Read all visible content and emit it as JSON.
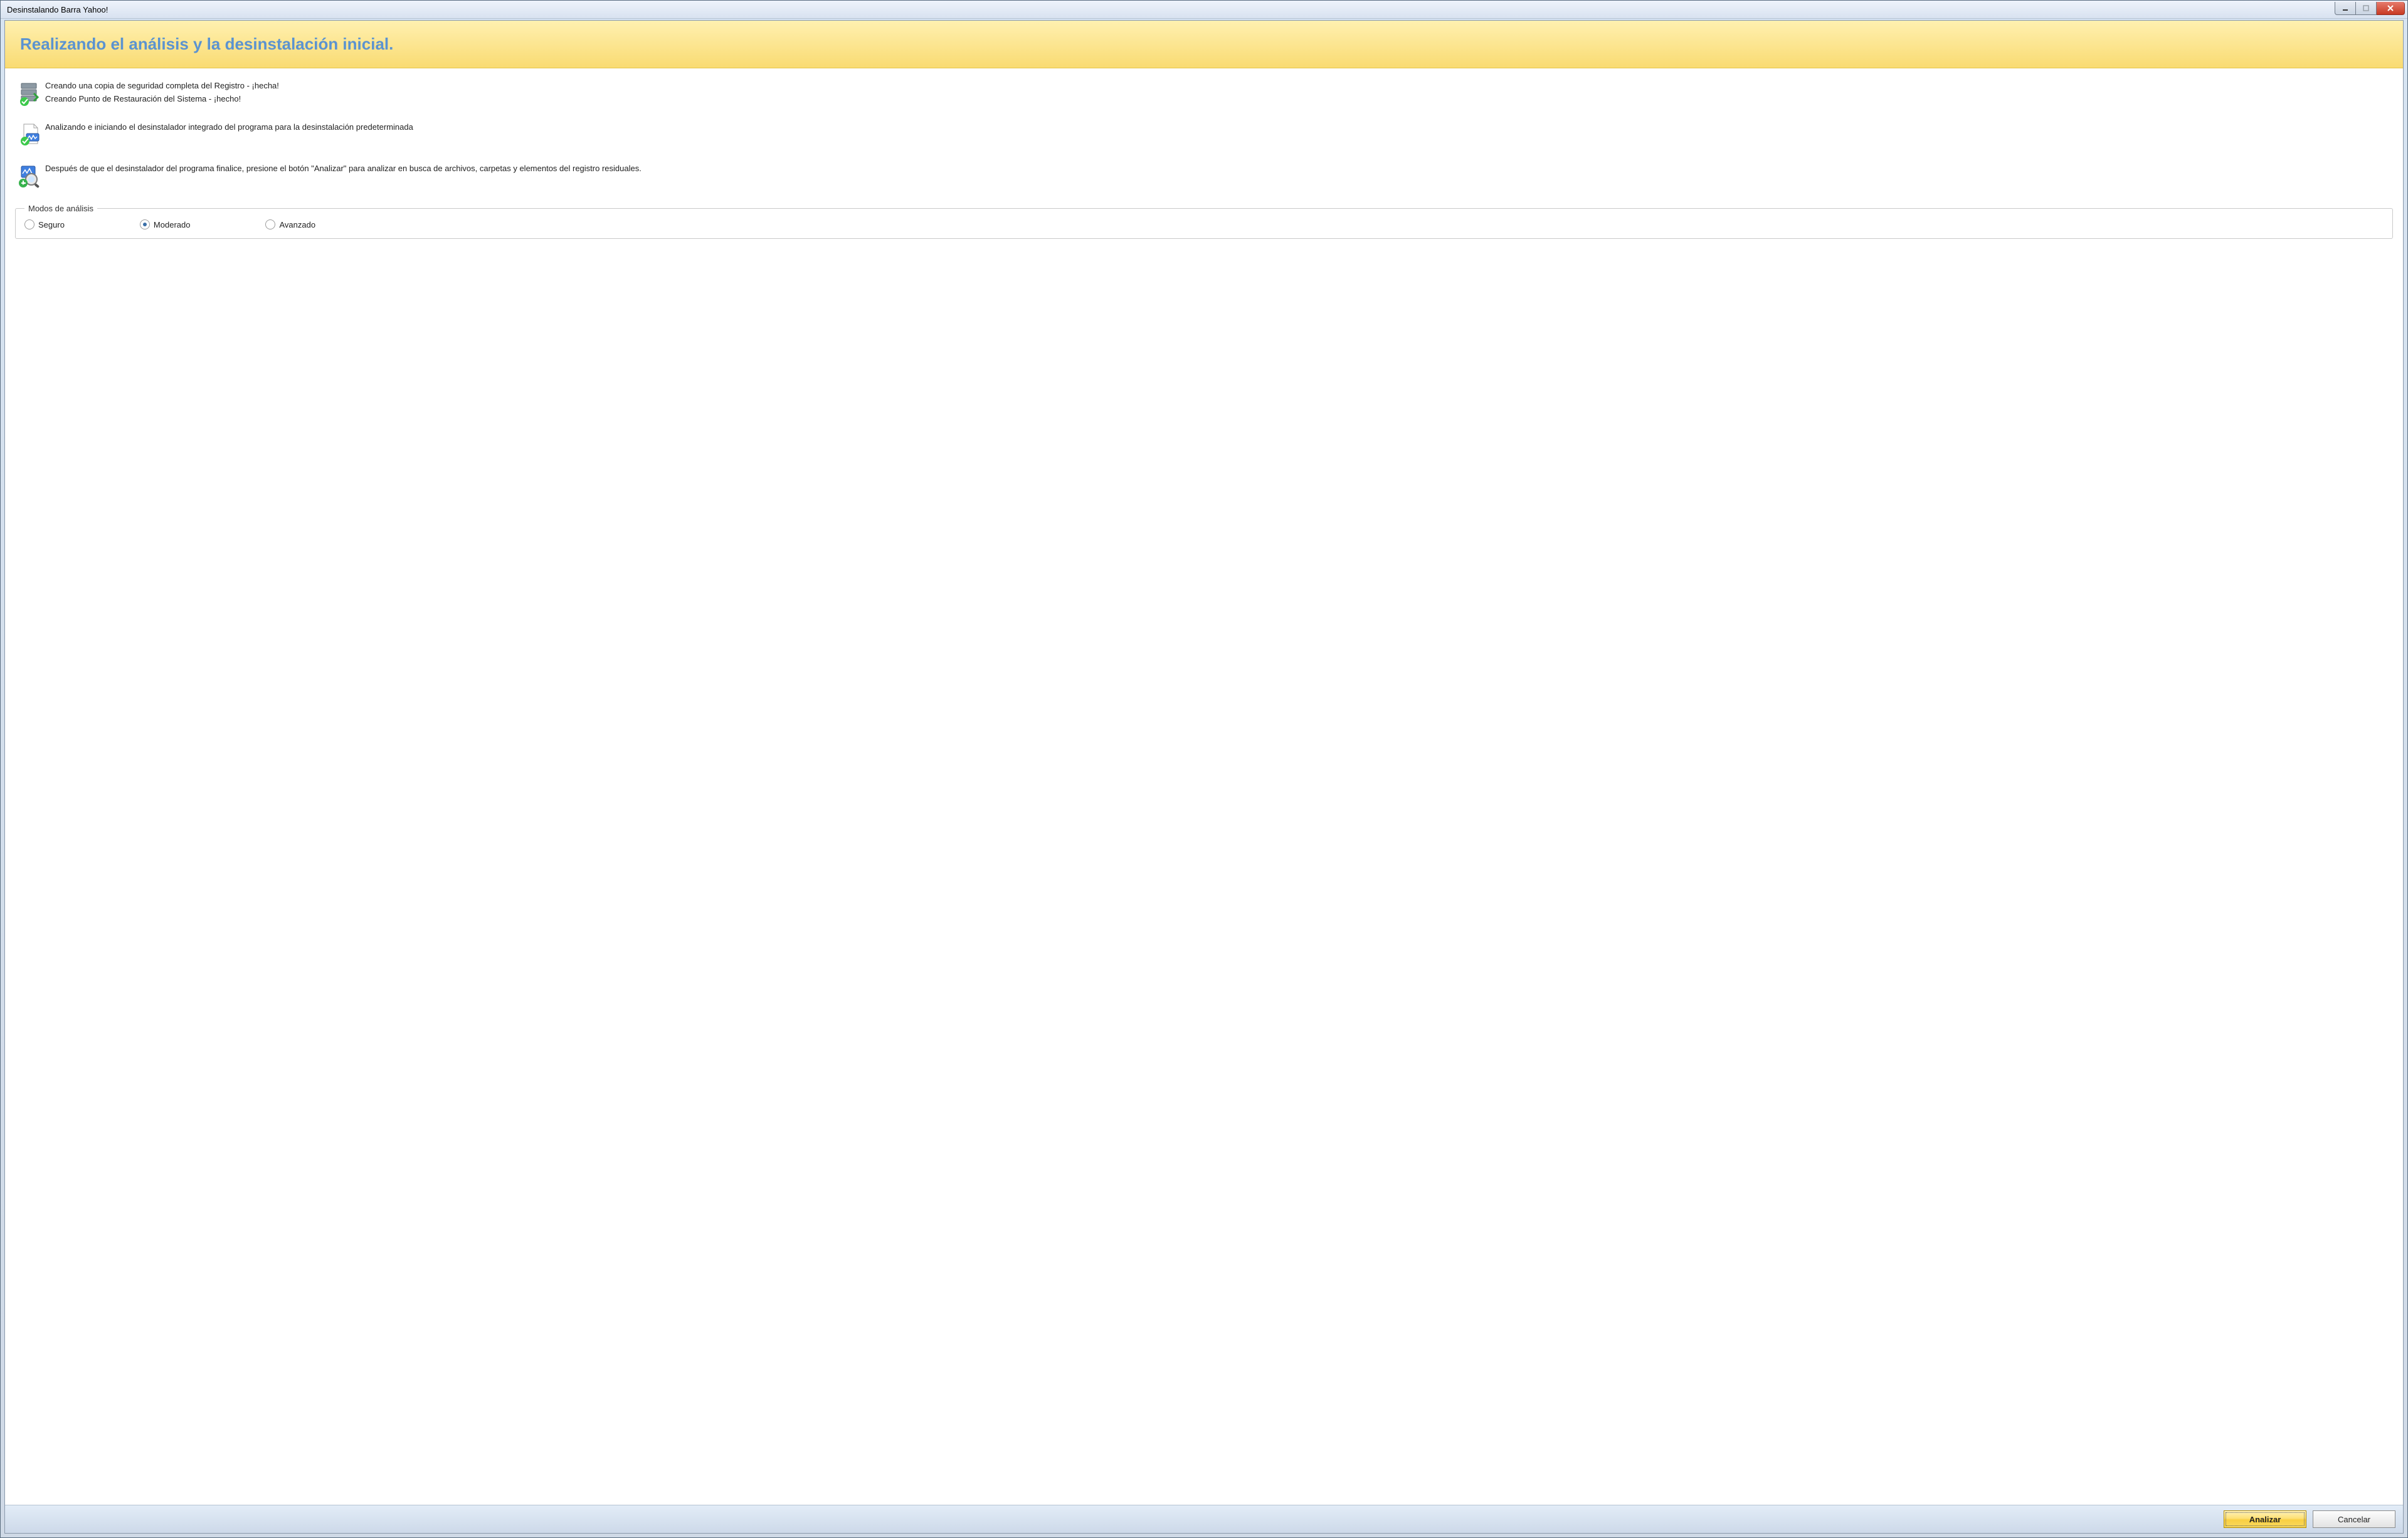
{
  "window": {
    "title": "Desinstalando Barra Yahoo!"
  },
  "header": {
    "title": "Realizando el análisis y la desinstalación inicial."
  },
  "steps": {
    "s1_line1": "Creando una copia de seguridad completa del Registro - ¡hecha!",
    "s1_line2": "Creando Punto de Restauración del Sistema - ¡hecho!",
    "s2": "Analizando e iniciando el desinstalador integrado del programa para la desinstalación predeterminada",
    "s3": "Después de que el desinstalador del programa finalice, presione el botón \"Analizar\" para analizar en busca de archivos, carpetas y elementos del registro residuales."
  },
  "modes": {
    "legend": "Modos de análisis",
    "options": [
      {
        "label": "Seguro",
        "selected": false
      },
      {
        "label": "Moderado",
        "selected": true
      },
      {
        "label": "Avanzado",
        "selected": false
      }
    ]
  },
  "footer": {
    "analyze": "Analizar",
    "cancel": "Cancelar"
  }
}
